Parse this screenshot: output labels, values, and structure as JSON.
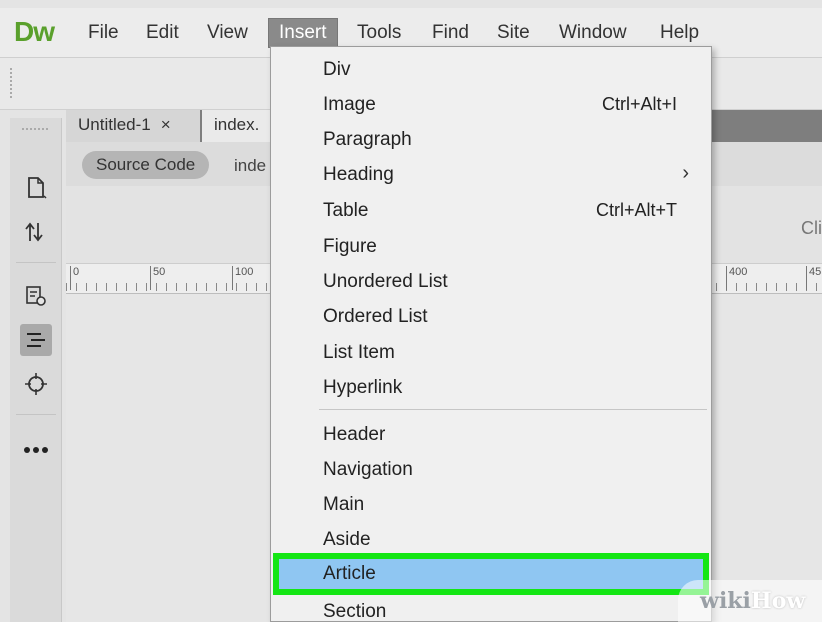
{
  "app": {
    "logo": "Dw"
  },
  "menubar": {
    "items": [
      {
        "label": "File"
      },
      {
        "label": "Edit"
      },
      {
        "label": "View"
      },
      {
        "label": "Insert"
      },
      {
        "label": "Tools"
      },
      {
        "label": "Find"
      },
      {
        "label": "Site"
      },
      {
        "label": "Window"
      },
      {
        "label": "Help"
      }
    ],
    "active": "Insert"
  },
  "rail": {
    "icons": [
      "new-file-icon",
      "transfer-icon",
      "inspect-icon",
      "code-format-icon",
      "target-icon",
      "more-icon"
    ]
  },
  "tabs": [
    {
      "label": "Untitled-1",
      "close": "×"
    },
    {
      "label": "index."
    }
  ],
  "docbar": {
    "source_code": "Source Code",
    "file": "inde"
  },
  "design": {
    "cli": "Cli"
  },
  "ruler": {
    "labels": [
      "0",
      "50",
      "100",
      "400",
      "45"
    ]
  },
  "insert_menu": {
    "items": [
      {
        "label": "Div"
      },
      {
        "label": "Image",
        "shortcut": "Ctrl+Alt+I"
      },
      {
        "label": "Paragraph"
      },
      {
        "label": "Heading",
        "submenu": "›"
      },
      {
        "label": "Table",
        "shortcut": "Ctrl+Alt+T"
      },
      {
        "label": "Figure"
      },
      {
        "label": "Unordered List"
      },
      {
        "label": "Ordered List"
      },
      {
        "label": "List Item"
      },
      {
        "label": "Hyperlink"
      },
      {
        "label": "Header"
      },
      {
        "label": "Navigation"
      },
      {
        "label": "Main"
      },
      {
        "label": "Aside"
      },
      {
        "label": "Article"
      },
      {
        "label": "Section"
      }
    ],
    "highlighted": "Article"
  },
  "watermark": {
    "wiki": "wiki",
    "how": "How"
  },
  "colors": {
    "logo": "#5aa02c",
    "highlight_border": "#14e614",
    "highlight_fill": "#8fc6f2"
  }
}
